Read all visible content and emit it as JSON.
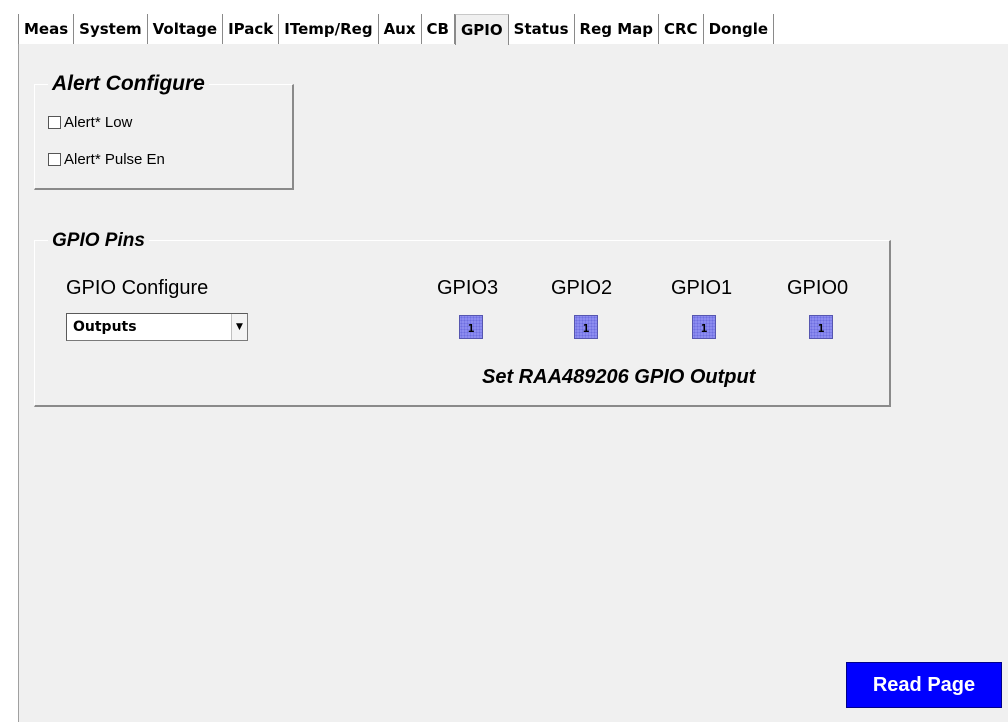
{
  "tabs": [
    {
      "label": "Meas"
    },
    {
      "label": "System"
    },
    {
      "label": "Voltage"
    },
    {
      "label": "IPack"
    },
    {
      "label": "ITemp/Reg"
    },
    {
      "label": "Aux"
    },
    {
      "label": "CB"
    },
    {
      "label": "GPIO"
    },
    {
      "label": "Status"
    },
    {
      "label": "Reg Map"
    },
    {
      "label": "CRC"
    },
    {
      "label": "Dongle"
    }
  ],
  "active_tab": "GPIO",
  "alert_configure": {
    "title": "Alert Configure",
    "alert_low": {
      "label": "Alert* Low",
      "checked": false
    },
    "alert_pulse_en": {
      "label": "Alert* Pulse En",
      "checked": false
    }
  },
  "gpio_pins": {
    "title": "GPIO  Pins",
    "configure_label": "GPIO Configure",
    "configure_value": "Outputs",
    "pins": [
      {
        "label": "GPIO3",
        "value": "1"
      },
      {
        "label": "GPIO2",
        "value": "1"
      },
      {
        "label": "GPIO1",
        "value": "1"
      },
      {
        "label": "GPIO0",
        "value": "1"
      }
    ],
    "set_label": "Set RAA489206 GPIO Output"
  },
  "read_page_label": "Read Page",
  "colors": {
    "read_button": "#0000ff",
    "gpio_button": "#8c8cf0",
    "panel_bg": "#f0f0f0"
  }
}
